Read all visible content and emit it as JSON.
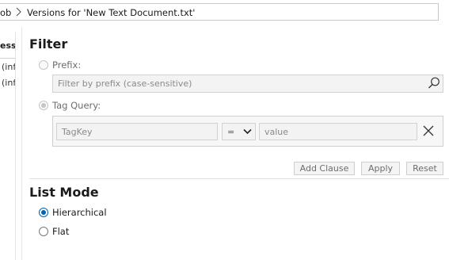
{
  "breadcrumb": {
    "parent_fragment": "ob",
    "current": "Versions for 'New Text Document.txt'"
  },
  "left_column": {
    "header": "ess",
    "cells": [
      "(inf",
      "(inf"
    ]
  },
  "filter": {
    "title": "Filter",
    "prefix": {
      "label": "Prefix:",
      "selected": false,
      "placeholder": "Filter by prefix (case-sensitive)"
    },
    "tag_query": {
      "label": "Tag Query:",
      "selected": true,
      "key_placeholder": "TagKey",
      "operator": "=",
      "value_placeholder": "value"
    },
    "buttons": {
      "add_clause": "Add Clause",
      "apply": "Apply",
      "reset": "Reset"
    }
  },
  "list_mode": {
    "title": "List Mode",
    "options": [
      {
        "label": "Hierarchical",
        "selected": true
      },
      {
        "label": "Flat",
        "selected": false
      }
    ]
  },
  "icons": {
    "separator": "chevron-right-icon",
    "search": "search-icon",
    "clear": "close-icon",
    "dropdown": "chevron-down-icon"
  },
  "colors": {
    "accent": "#0063b1",
    "border": "#cfcfcf",
    "disabled_text": "#6d6d6d"
  }
}
